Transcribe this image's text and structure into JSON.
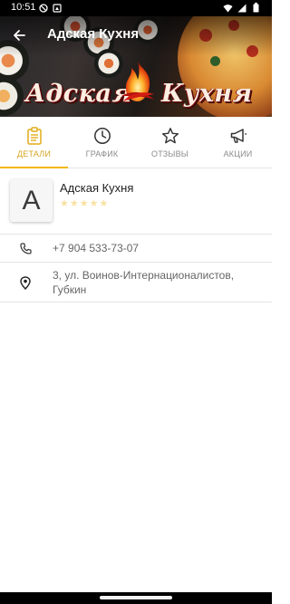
{
  "status_bar": {
    "time": "10:51",
    "icons": [
      "no-disturb-icon",
      "screenshot-icon",
      "wifi-icon",
      "signal-icon",
      "battery-icon"
    ]
  },
  "header": {
    "back_icon": "arrow-left-icon",
    "title": "Адская Кухня",
    "logo_left": "Адская",
    "logo_right": "Кухня"
  },
  "tabs": [
    {
      "id": "details",
      "label": "ДЕТАЛИ",
      "icon": "clipboard-icon",
      "active": true
    },
    {
      "id": "schedule",
      "label": "ГРАФИК",
      "icon": "clock-icon",
      "active": false
    },
    {
      "id": "reviews",
      "label": "ОТЗЫВЫ",
      "icon": "star-outline-icon",
      "active": false
    },
    {
      "id": "promos",
      "label": "АКЦИИ",
      "icon": "megaphone-icon",
      "active": false
    }
  ],
  "profile": {
    "avatar_letter": "A",
    "name": "Адская Кухня",
    "stars": "★★★★★",
    "rating": 0
  },
  "contact": {
    "phone": "+7 904 533-73-07",
    "address": "3, ул. Воинов-Интернационалистов, Губкин"
  },
  "colors": {
    "accent": "#f2b705",
    "active_label": "#d8a623",
    "inactive_label": "#8b8b8b"
  }
}
